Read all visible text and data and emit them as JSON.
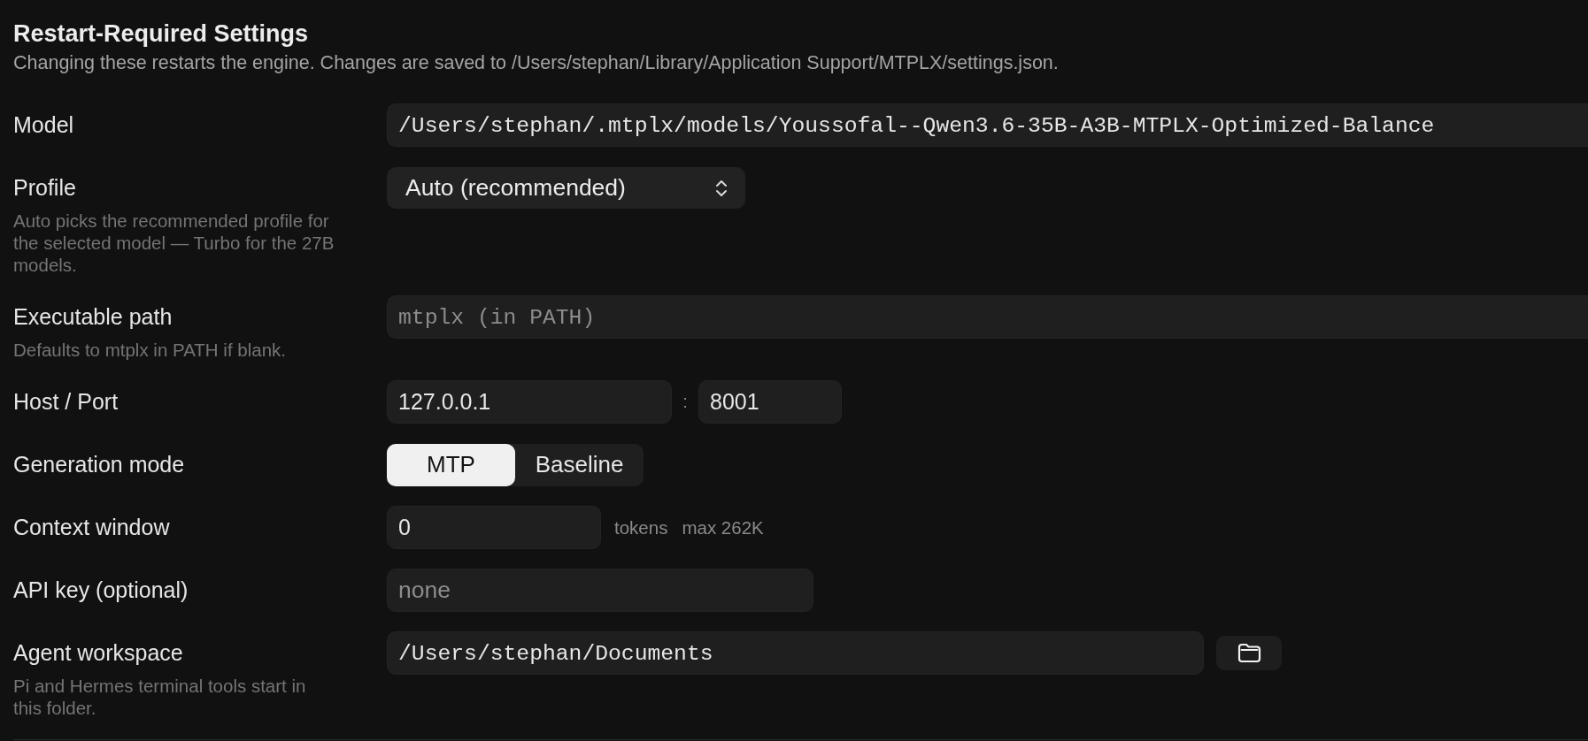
{
  "section": {
    "title": "Restart-Required Settings",
    "description": "Changing these restarts the engine. Changes are saved to /Users/stephan/Library/Application Support/MTPLX/settings.json."
  },
  "rows": [
    {
      "kind": "path_field",
      "label": "Model",
      "value": "/Users/stephan/.mtplx/models/Youssofal--Qwen3.6-35B-A3B-MTPLX-Optimized-Balance"
    },
    {
      "kind": "select",
      "label": "Profile",
      "hint": "Auto picks the recommended profile for the selected model — Turbo for the 27B models.",
      "value": "Auto (recommended)"
    },
    {
      "kind": "path_field",
      "label": "Executable path",
      "hint": "Defaults to mtplx in PATH if blank.",
      "placeholder": "mtplx (in PATH)"
    },
    {
      "kind": "host_port",
      "label": "Host / Port",
      "host": "127.0.0.1",
      "separator": ":",
      "port": "8001"
    },
    {
      "kind": "segmented",
      "label": "Generation mode",
      "options": [
        {
          "label": "MTP",
          "selected": true
        },
        {
          "label": "Baseline",
          "selected": false
        }
      ]
    },
    {
      "kind": "number_field",
      "label": "Context window",
      "value": "0",
      "unit": "tokens",
      "note": "max 262K"
    },
    {
      "kind": "text_field",
      "label": "API key (optional)",
      "placeholder": "none"
    },
    {
      "kind": "folder_field",
      "label": "Agent workspace",
      "hint": "Pi and Hermes terminal tools start in this folder.",
      "value": "/Users/stephan/Documents"
    }
  ]
}
